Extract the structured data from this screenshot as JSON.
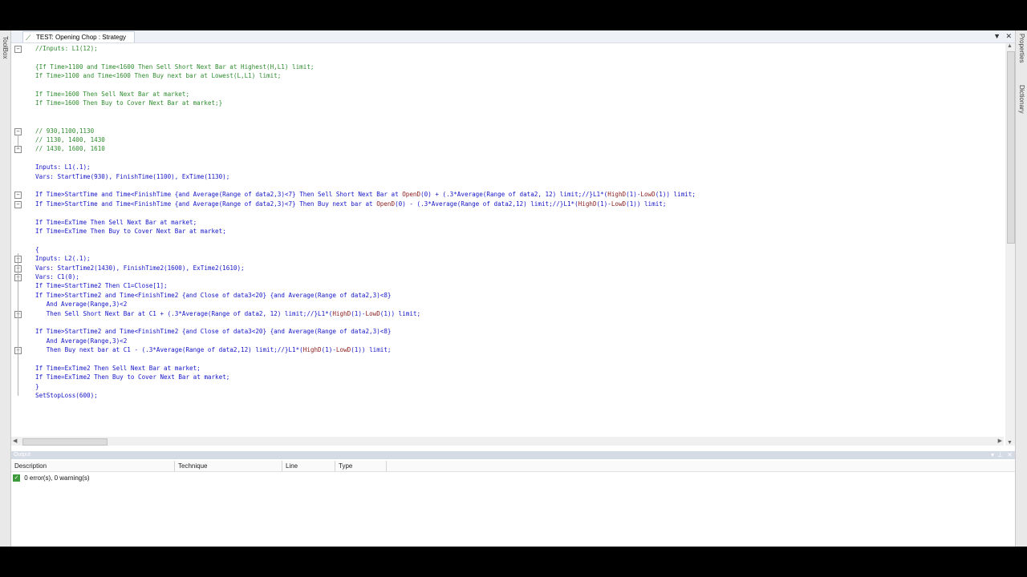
{
  "left_strip": {
    "toolbox_label": "ToolBox"
  },
  "right_strip": {
    "properties_label": "Properties",
    "dictionary_label": "Dictionary"
  },
  "document_tab": {
    "title": "TEST: Opening Chop : Strategy",
    "icon": "strategy-icon"
  },
  "tab_controls": {
    "dropdown": "▼",
    "close": "✕"
  },
  "code_lines": [
    "//Inputs: L1(12);",
    "",
    "{If Time>1100 and Time<1600 Then Sell Short Next Bar at Highest(H,L1) limit;",
    "If Time>1100 and Time<1600 Then Buy next bar at Lowest(L,L1) limit;",
    "",
    "If Time=1600 Then Sell Next Bar at market;",
    "If Time=1600 Then Buy to Cover Next Bar at market;}",
    "",
    "",
    "// 930,1100,1130",
    "// 1130, 1400, 1430",
    "// 1430, 1600, 1610",
    "",
    "Inputs: L1(.1);",
    "Vars: StartTime(930), FinishTime(1100), ExTime(1130);",
    "",
    "If Time>StartTime and Time<FinishTime {and Average(Range of data2,3)<7} Then Sell Short Next Bar at OpenD(0) + (.3*Average(Range of data2, 12) limit;//}L1*(HighD(1)-LowD(1)) limit;",
    "If Time>StartTime and Time<FinishTime {and Average(Range of data2,3)<7} Then Buy next bar at OpenD(0) - (.3*Average(Range of data2,12) limit;//}L1*(HighD(1)-LowD(1)) limit;",
    "",
    "If Time=ExTime Then Sell Next Bar at market;",
    "If Time=ExTime Then Buy to Cover Next Bar at market;",
    "",
    "{",
    "Inputs: L2(.1);",
    "Vars: StartTime2(1430), FinishTime2(1600), ExTime2(1610);",
    "Vars: C1(0);",
    "If Time=StartTime2 Then C1=Close[1];",
    "If Time>StartTime2 and Time<FinishTime2 {and Close of data3<20} {and Average(Range of data2,3)<8}",
    "   And Average(Range,3)<2",
    "   Then Sell Short Next Bar at C1 + (.3*Average(Range of data2, 12) limit;//}L1*(HighD(1)-LowD(1)) limit;",
    "",
    "If Time>StartTime2 and Time<FinishTime2 {and Close of data3<20} {and Average(Range of data2,3)<8}",
    "   And Average(Range,3)<2",
    "   Then Buy next bar at C1 - (.3*Average(Range of data2,12) limit;//}L1*(HighD(1)-LowD(1)) limit;",
    "",
    "If Time=ExTime2 Then Sell Next Bar at market;",
    "If Time=ExTime2 Then Buy to Cover Next Bar at market;",
    "}",
    "SetStopLoss(600);"
  ],
  "output": {
    "title": "Output",
    "columns": [
      "Description",
      "Technique",
      "Line",
      "Type"
    ],
    "message": "0 error(s), 0 warning(s)",
    "status_icon": "check-icon"
  },
  "colors": {
    "comment": "#2e8b2e",
    "keyword": "#1414c8",
    "function": "#8b1a1a"
  }
}
